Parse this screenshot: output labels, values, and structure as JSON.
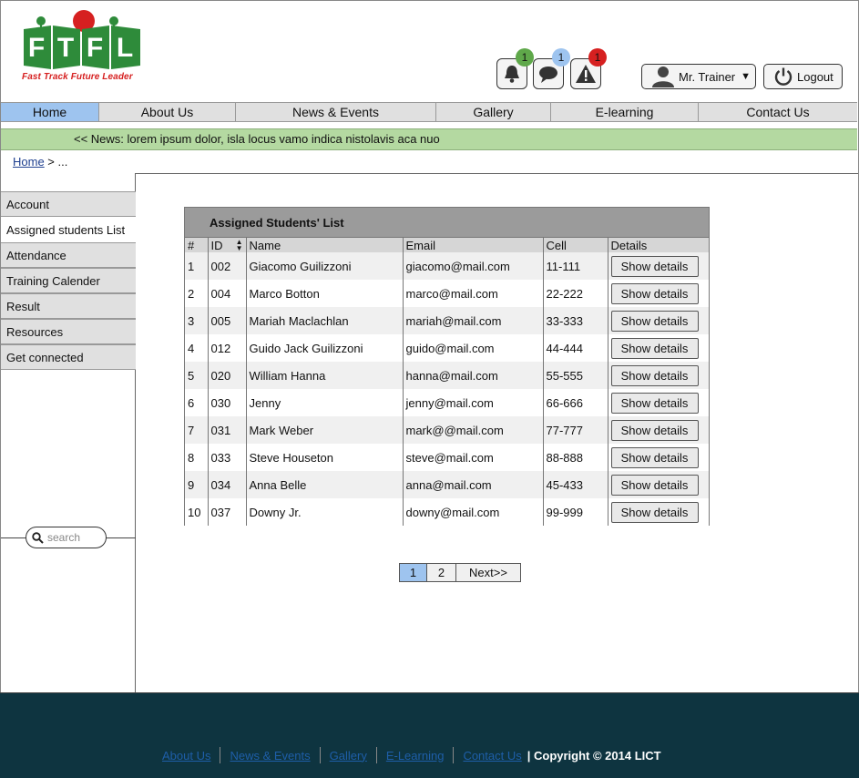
{
  "brand": {
    "logo_tagline": "Fast Track Future Leader",
    "logo_letters": [
      "F",
      "T",
      "F",
      "L"
    ]
  },
  "header": {
    "notifications_count": "1",
    "messages_count": "1",
    "alerts_count": "1",
    "user_label": "Mr. Trainer",
    "logout_label": "Logout"
  },
  "nav": {
    "items": [
      {
        "label": "Home"
      },
      {
        "label": "About Us"
      },
      {
        "label": "News & Events"
      },
      {
        "label": "Gallery"
      },
      {
        "label": "E-learning"
      },
      {
        "label": "Contact Us"
      }
    ]
  },
  "news": {
    "text": "<< News: lorem ipsum dolor, isla locus vamo indica nistolavis aca nuo"
  },
  "breadcrumb": {
    "home": "Home",
    "rest": " > ..."
  },
  "sidebar": {
    "items": [
      {
        "label": "Account"
      },
      {
        "label": "Assigned students List"
      },
      {
        "label": "Attendance"
      },
      {
        "label": "Training Calender"
      },
      {
        "label": "Result"
      },
      {
        "label": "Resources"
      },
      {
        "label": "Get connected"
      }
    ],
    "search_placeholder": "search"
  },
  "table": {
    "title": "Assigned Students' List",
    "headers": {
      "num": "#",
      "id": "ID",
      "name": "Name",
      "email": "Email",
      "cell": "Cell",
      "details": "Details"
    },
    "button_label": "Show details",
    "rows": [
      {
        "num": "1",
        "id": "002",
        "name": "Giacomo Guilizzoni",
        "email": "giacomo@mail.com",
        "cell": "11-111"
      },
      {
        "num": "2",
        "id": "004",
        "name": "Marco Botton",
        "email": "marco@mail.com",
        "cell": "22-222"
      },
      {
        "num": "3",
        "id": "005",
        "name": "Mariah Maclachlan",
        "email": "mariah@mail.com",
        "cell": "33-333"
      },
      {
        "num": "4",
        "id": "012",
        "name": "Guido Jack Guilizzoni",
        "email": "guido@mail.com",
        "cell": "44-444"
      },
      {
        "num": "5",
        "id": "020",
        "name": "William Hanna",
        "email": "hanna@mail.com",
        "cell": "55-555"
      },
      {
        "num": "6",
        "id": "030",
        "name": "Jenny",
        "email": "jenny@mail.com",
        "cell": "66-666"
      },
      {
        "num": "7",
        "id": "031",
        "name": "Mark Weber",
        "email": "mark@@mail.com",
        "cell": "77-777"
      },
      {
        "num": "8",
        "id": "033",
        "name": "Steve Houseton",
        "email": "steve@mail.com",
        "cell": "88-888"
      },
      {
        "num": "9",
        "id": "034",
        "name": "Anna Belle",
        "email": "anna@mail.com",
        "cell": "45-433"
      },
      {
        "num": "10",
        "id": "037",
        "name": "Downy Jr.",
        "email": "downy@mail.com",
        "cell": "99-999"
      }
    ]
  },
  "pagination": {
    "pages": [
      "1",
      "2"
    ],
    "next": "Next>>"
  },
  "footer": {
    "links": [
      {
        "label": "About Us"
      },
      {
        "label": "News & Events"
      },
      {
        "label": "Gallery"
      },
      {
        "label": "E-Learning"
      },
      {
        "label": "Contact Us"
      }
    ],
    "copyright": "| Copyright © 2014 LICT"
  },
  "colors": {
    "nav_active": "#9ec4ef",
    "news_bar": "#b4d9a1",
    "footer_bg": "#0e3440",
    "badge_green": "#5fa84a",
    "badge_blue": "#9ec4ef",
    "badge_red": "#d62020",
    "logo_green": "#2e8b3a"
  }
}
